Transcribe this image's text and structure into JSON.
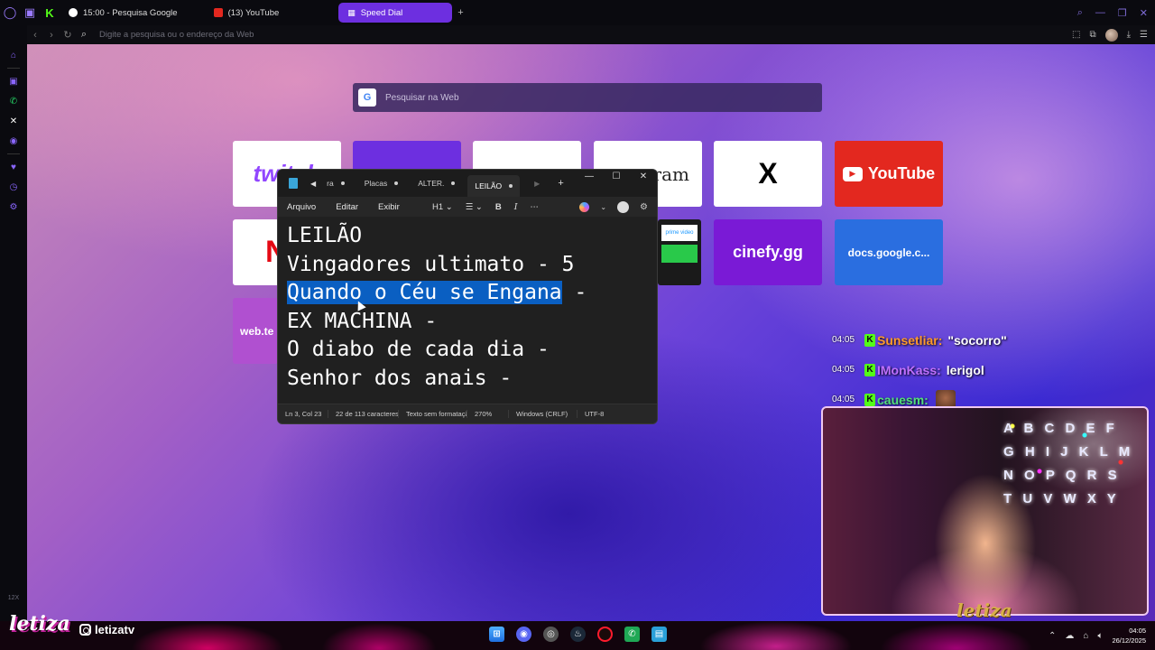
{
  "browser": {
    "tabs": [
      {
        "label": "15:00 - Pesquisa Google",
        "icon": "google-icon"
      },
      {
        "label": "(13) YouTube",
        "icon": "youtube-icon"
      },
      {
        "label": "Speed Dial",
        "icon": "speed-dial-icon",
        "active": true
      }
    ],
    "address_placeholder": "Digite a pesquisa ou o endereço da Web"
  },
  "sidebar": {
    "zoom_label": "12X"
  },
  "speed_dial": {
    "search_placeholder": "Pesquisar na Web",
    "tiles": [
      {
        "label": "twitch",
        "color": "#9146ff"
      },
      {
        "label": "",
        "color": "#6d2fe0"
      },
      {
        "label": "",
        "color": "#ffffff"
      },
      {
        "label": "ram",
        "color": "#ffffff"
      },
      {
        "label": "X",
        "color": "#ffffff"
      },
      {
        "label": "YouTube",
        "color": "#e3281f"
      },
      {
        "label": "N",
        "color": "#ffffff"
      },
      {
        "label": "prime video",
        "color": "#ffffff"
      },
      {
        "label": "cinefy.gg",
        "color": "#7a1ad6"
      },
      {
        "label": "docs.google.c...",
        "color": "#2a6ee0"
      },
      {
        "label": "web.te",
        "color": "#b050d0"
      }
    ]
  },
  "notepad": {
    "tabs": [
      "ra",
      "Placas",
      "ALTER.",
      "LEILÃO"
    ],
    "menu": [
      "Arquivo",
      "Editar",
      "Exibir"
    ],
    "heading": "H1",
    "lines": [
      {
        "pre": "LEILÃO",
        "sel": "",
        "post": ""
      },
      {
        "pre": "Vingadores ultimato - 5",
        "sel": "",
        "post": ""
      },
      {
        "pre": "",
        "sel": "Quando o Céu se Engana",
        "post": " -"
      },
      {
        "pre": "EX MACHINA -",
        "sel": "",
        "post": ""
      },
      {
        "pre": "O diabo de cada dia -",
        "sel": "",
        "post": ""
      },
      {
        "pre": "Senhor dos anais -",
        "sel": "",
        "post": ""
      }
    ],
    "status": {
      "position": "Ln 3, Col 23",
      "chars": "22 de 113 caracteres",
      "format": "Texto sem formatação",
      "zoom": "270%",
      "line_ending": "Windows (CRLF)",
      "encoding": "UTF-8"
    }
  },
  "chat": [
    {
      "time": "04:05",
      "user": "Sunsetliar:",
      "user_color": "#ff9a2a",
      "msg": "\"socorro\""
    },
    {
      "time": "04:05",
      "user": "IMonKass:",
      "user_color": "#c070ff",
      "msg": "lerigol"
    },
    {
      "time": "04:05",
      "user": "cauesm:",
      "user_color": "#52e07a",
      "msg": ""
    }
  ],
  "webcam": {
    "letters": "A B C D E F G H I J K L M N O P Q R S T U V W X Y",
    "watermark": "letiza"
  },
  "overlay": {
    "brand": "letiza",
    "handle": "letizatv"
  },
  "taskbar": {
    "time": "04:05",
    "date": "26/12/2025"
  }
}
